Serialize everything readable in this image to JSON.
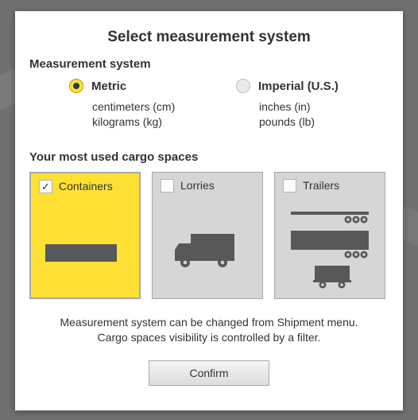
{
  "title": "Select measurement system",
  "measurement": {
    "heading": "Measurement system",
    "options": [
      {
        "id": "metric",
        "label": "Metric",
        "sub1": "centimeters (cm)",
        "sub2": "kilograms (kg)",
        "selected": true
      },
      {
        "id": "imperial",
        "label": "Imperial (U.S.)",
        "sub1": "inches (in)",
        "sub2": "pounds (lb)",
        "selected": false
      }
    ]
  },
  "cargo": {
    "heading": "Your most used cargo spaces",
    "cards": [
      {
        "id": "containers",
        "label": "Containers",
        "selected": true
      },
      {
        "id": "lorries",
        "label": "Lorries",
        "selected": false
      },
      {
        "id": "trailers",
        "label": "Trailers",
        "selected": false
      }
    ]
  },
  "info": {
    "line1": "Measurement system can be changed from Shipment menu.",
    "line2": "Cargo spaces visibility is controlled by a filter."
  },
  "buttons": {
    "confirm": "Confirm"
  },
  "colors": {
    "accent": "#ffe135",
    "dark": "#585858",
    "panel": "#d6d6d6"
  }
}
